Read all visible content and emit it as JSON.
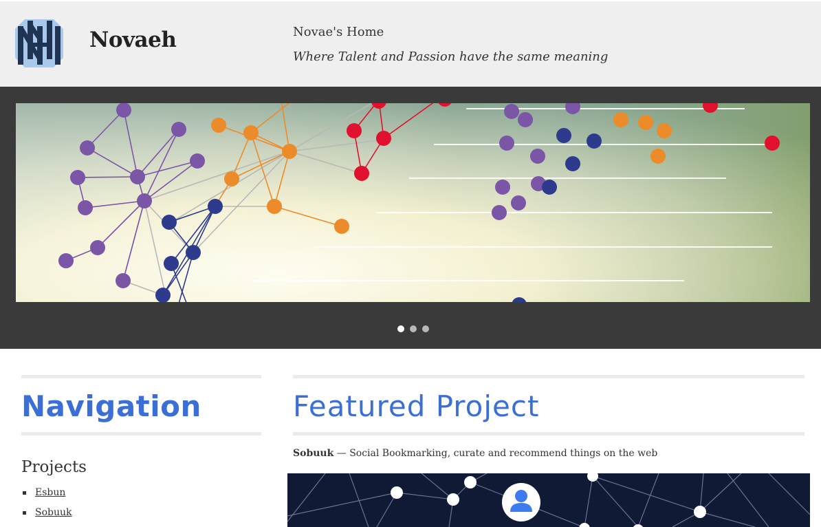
{
  "header": {
    "site_name": "Novaeh",
    "home_title": "Novae's Home",
    "tagline": "Where Talent and Passion have the same meaning",
    "logo_icon": "novaeh-logo-icon"
  },
  "hero": {
    "slide_count": 3,
    "active_slide": 1,
    "colors": {
      "background": "#3a3a3a",
      "purple": "#7b55a6",
      "orange": "#ec8b2a",
      "red": "#e0102e",
      "navy": "#2e3a8c"
    }
  },
  "navigation": {
    "heading": "Navigation",
    "projects_heading": "Projects",
    "projects": [
      "Esbun",
      "Sobuuk"
    ]
  },
  "featured": {
    "heading": "Featured Project",
    "project_name": "Sobuuk",
    "project_description": " — Social Bookmarking, curate and recommend things on the web"
  },
  "colors": {
    "accent": "#3c6fd6",
    "header_bg": "#efefef",
    "featured_image_bg": "#101a35"
  }
}
